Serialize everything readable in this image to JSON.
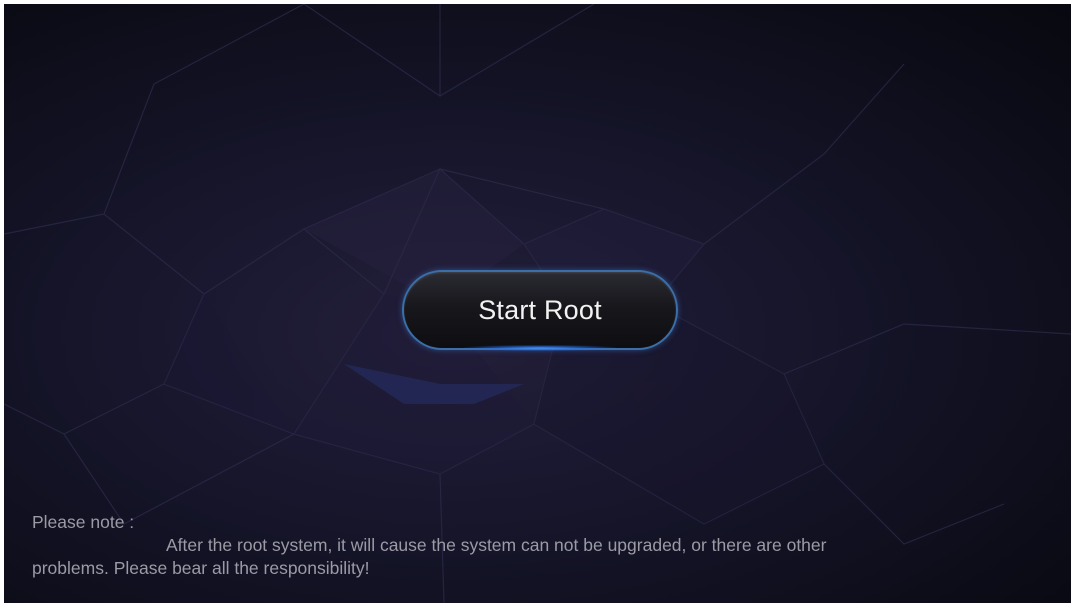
{
  "main": {
    "button_label": "Start Root"
  },
  "note": {
    "heading": "Please note :",
    "line1": "After the root system, it will cause the system can not be upgraded, or there are other",
    "line2": "problems. Please bear all the responsibility!"
  },
  "colors": {
    "background": "#141428",
    "button_border": "#3b6fa8",
    "button_glow": "#4696ff",
    "note_text": "#9b9ba6"
  }
}
